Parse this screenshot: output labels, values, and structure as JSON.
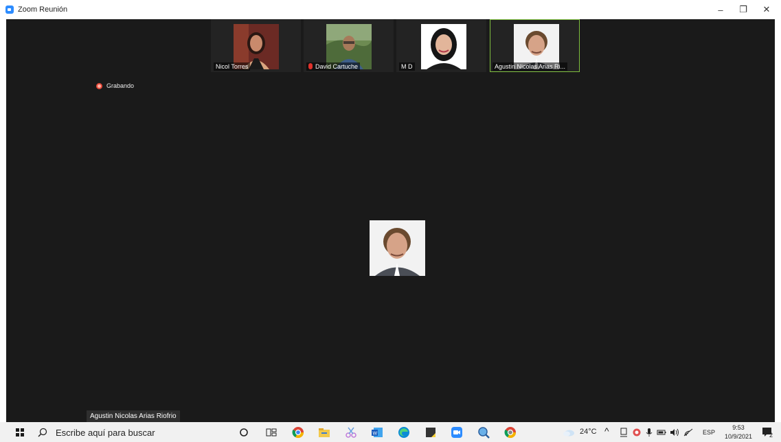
{
  "window": {
    "title": "Zoom Reunión",
    "minimize_glyph": "–",
    "restore_glyph": "❐",
    "close_glyph": "✕"
  },
  "meeting": {
    "recording_label": "Grabando",
    "active_speaker_name": "Agustin Nicolas Arias Riofrio",
    "thumbnails": [
      {
        "name": "Nicol Torres",
        "muted": false,
        "active": false
      },
      {
        "name": "David Cartuche",
        "muted": true,
        "active": false
      },
      {
        "name": "M D",
        "muted": false,
        "active": false
      },
      {
        "name": "Agustin Nicolas Arias Ri...",
        "muted": false,
        "active": true
      }
    ]
  },
  "taskbar": {
    "search_placeholder": "Escribe aquí para buscar",
    "weather": "24°C",
    "language": "ESP",
    "time": "9:53",
    "date": "10/9/2021",
    "notification_count": "2"
  },
  "colors": {
    "meeting_bg": "#1a1a1a",
    "active_border": "#7fbf3f",
    "record_red": "#e74c3c",
    "zoom_blue": "#2d8cff"
  }
}
